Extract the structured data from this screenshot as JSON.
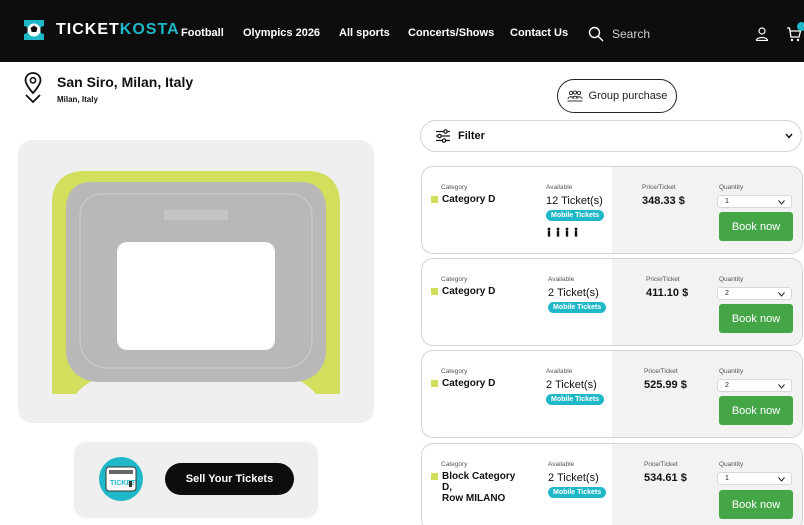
{
  "nav": {
    "brand_a": "TICKET",
    "brand_b": "KOSTA",
    "links": [
      "Football",
      "Olympics 2026",
      "All sports",
      "Concerts/Shows",
      "Contact Us"
    ],
    "search_placeholder": "Search"
  },
  "venue": {
    "name": "San Siro, Milan, Italy",
    "location": "Milan, Italy"
  },
  "group_purchase_label": "Group purchase",
  "filter_label": "Filter",
  "sell_label": "Sell Your Tickets",
  "sell_illus_text": "TICKET",
  "labels": {
    "category": "Category",
    "available": "Available",
    "price": "Price/Ticket",
    "quantity": "Quantity",
    "book": "Book now",
    "mobile": "Mobile Tickets"
  },
  "listings": [
    {
      "category": "Category D",
      "available": "12 Ticket(s)",
      "price": "348.33 $",
      "quantity": "1",
      "people_icons": 4
    },
    {
      "category": "Category D",
      "available": "2 Ticket(s)",
      "price": "411.10 $",
      "quantity": "2",
      "people_icons": 0
    },
    {
      "category": "Category D",
      "available": "2 Ticket(s)",
      "price": "525.99 $",
      "quantity": "2",
      "people_icons": 0
    },
    {
      "category_lines": [
        "Block Category",
        "D,",
        "Row MILANO"
      ],
      "available": "2 Ticket(s)",
      "price": "534.61 $",
      "quantity": "1",
      "people_icons": 0
    }
  ],
  "colors": {
    "accent": "#1fb8c8",
    "book_green": "#45a648",
    "category_d": "#d1df5d",
    "nav_bg": "#0d0d0d"
  }
}
